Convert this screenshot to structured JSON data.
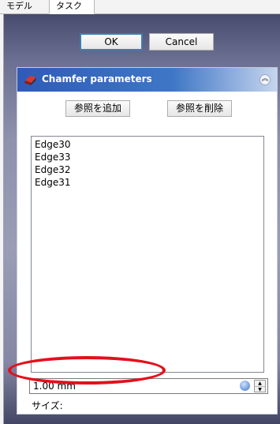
{
  "tabs": [
    {
      "label": "モデル"
    },
    {
      "label": "タスク"
    }
  ],
  "buttons": {
    "ok": "OK",
    "cancel": "Cancel"
  },
  "chamfer": {
    "title": "Chamfer parameters",
    "add_reference": "参照を追加",
    "remove_reference": "参照を削除",
    "edges": [
      "Edge30",
      "Edge33",
      "Edge32",
      "Edge31"
    ],
    "size_value": "1.00 mm",
    "size_label": "サイズ:"
  },
  "icons": {
    "header": "chamfer-icon",
    "collapse": "double-chevron-up-icon",
    "reset": "reset-icon"
  },
  "colors": {
    "header_blue": "#2e5bb8",
    "annotation_red": "#e3101c",
    "default_button_border": "#3c7fb1"
  }
}
